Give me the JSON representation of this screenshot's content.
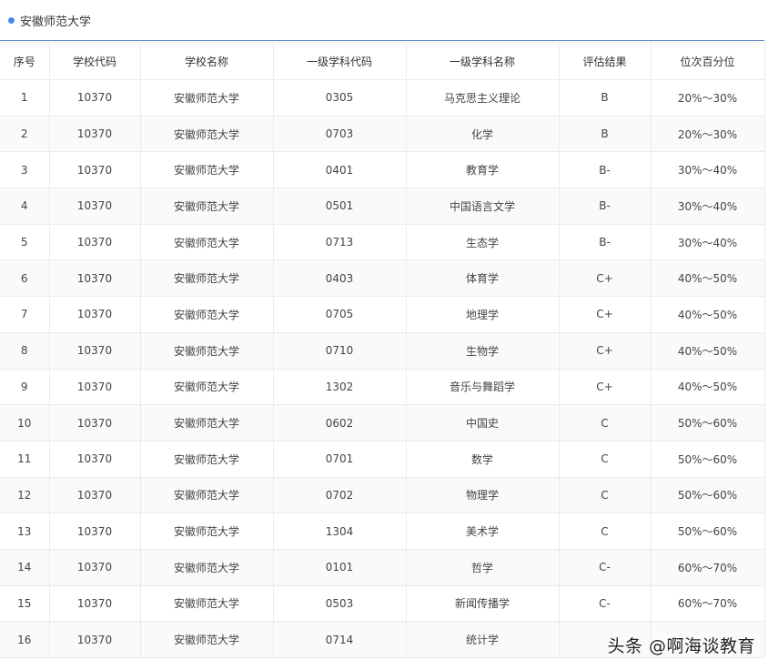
{
  "page": {
    "title": "安徽师范大学"
  },
  "table": {
    "headers": [
      "序号",
      "学校代码",
      "学校名称",
      "一级学科代码",
      "一级学科名称",
      "评估结果",
      "位次百分位"
    ],
    "rows": [
      [
        "1",
        "10370",
        "安徽师范大学",
        "0305",
        "马克思主义理论",
        "B",
        "20%～30%"
      ],
      [
        "2",
        "10370",
        "安徽师范大学",
        "0703",
        "化学",
        "B",
        "20%～30%"
      ],
      [
        "3",
        "10370",
        "安徽师范大学",
        "0401",
        "教育学",
        "B-",
        "30%～40%"
      ],
      [
        "4",
        "10370",
        "安徽师范大学",
        "0501",
        "中国语言文学",
        "B-",
        "30%～40%"
      ],
      [
        "5",
        "10370",
        "安徽师范大学",
        "0713",
        "生态学",
        "B-",
        "30%～40%"
      ],
      [
        "6",
        "10370",
        "安徽师范大学",
        "0403",
        "体育学",
        "C+",
        "40%～50%"
      ],
      [
        "7",
        "10370",
        "安徽师范大学",
        "0705",
        "地理学",
        "C+",
        "40%～50%"
      ],
      [
        "8",
        "10370",
        "安徽师范大学",
        "0710",
        "生物学",
        "C+",
        "40%～50%"
      ],
      [
        "9",
        "10370",
        "安徽师范大学",
        "1302",
        "音乐与舞蹈学",
        "C+",
        "40%～50%"
      ],
      [
        "10",
        "10370",
        "安徽师范大学",
        "0602",
        "中国史",
        "C",
        "50%～60%"
      ],
      [
        "11",
        "10370",
        "安徽师范大学",
        "0701",
        "数学",
        "C",
        "50%～60%"
      ],
      [
        "12",
        "10370",
        "安徽师范大学",
        "0702",
        "物理学",
        "C",
        "50%～60%"
      ],
      [
        "13",
        "10370",
        "安徽师范大学",
        "1304",
        "美术学",
        "C",
        "50%～60%"
      ],
      [
        "14",
        "10370",
        "安徽师范大学",
        "0101",
        "哲学",
        "C-",
        "60%～70%"
      ],
      [
        "15",
        "10370",
        "安徽师范大学",
        "0503",
        "新闻传播学",
        "C-",
        "60%～70%"
      ],
      [
        "16",
        "10370",
        "安徽师范大学",
        "0714",
        "统计学",
        "",
        ""
      ]
    ]
  },
  "watermark": {
    "text": "头条 @啊海谈教育"
  }
}
